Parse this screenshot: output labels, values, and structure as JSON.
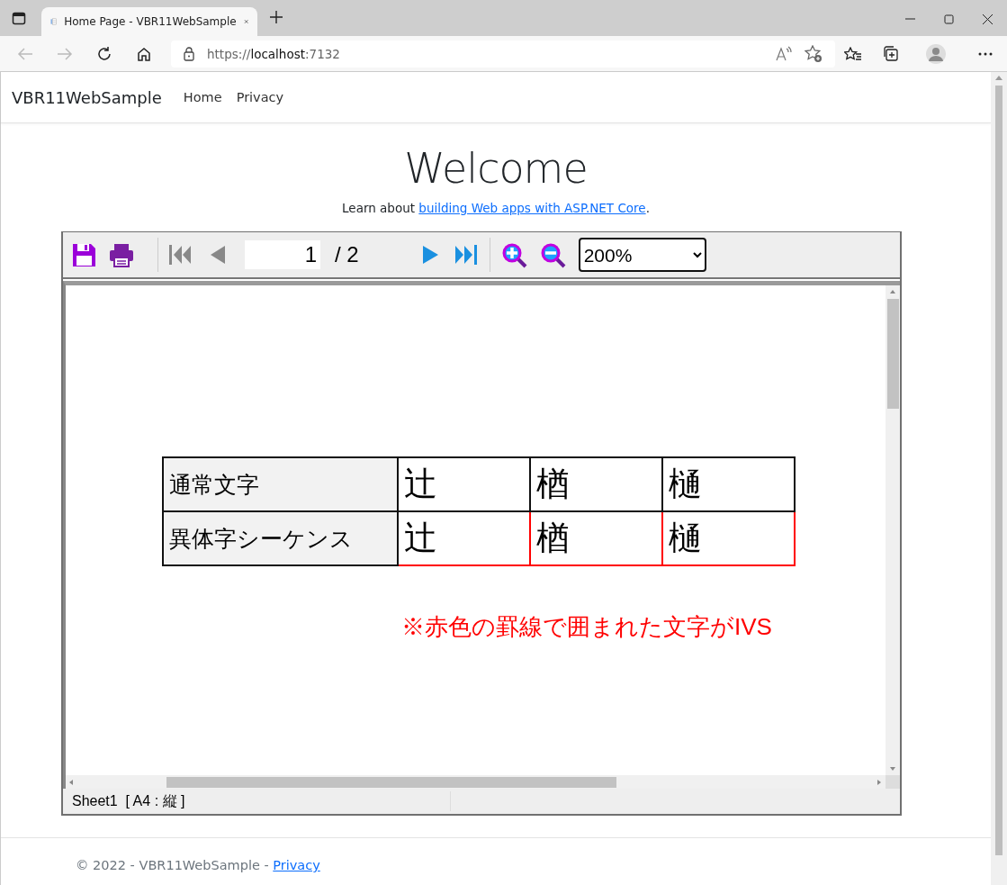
{
  "browser": {
    "tab_title": "Home Page - VBR11WebSample",
    "url_scheme": "https://",
    "url_host": "localhost",
    "url_port": ":7132"
  },
  "navbar": {
    "brand": "VBR11WebSample",
    "links": [
      {
        "label": "Home"
      },
      {
        "label": "Privacy"
      }
    ]
  },
  "heading": "Welcome",
  "intro": {
    "text": "Learn about ",
    "link": "building Web apps with ASP.NET Core",
    "after": "."
  },
  "viewer": {
    "page_input": "1",
    "page_total": "/ 2",
    "zoom": "200%",
    "table": {
      "rows": [
        {
          "kind": "normal",
          "label": "通常文字",
          "cells": [
            "辻",
            "楢",
            "樋"
          ]
        },
        {
          "kind": "variant",
          "label": "異体字シーケンス",
          "cells": [
            "辻",
            "楢",
            "樋"
          ]
        }
      ]
    },
    "note": "※赤色の罫線で囲まれた文字がIVS",
    "status": "Sheet1  [ A4 : 縦 ]"
  },
  "footer": {
    "text": "© 2022 - VBR11WebSample - ",
    "link": "Privacy"
  }
}
